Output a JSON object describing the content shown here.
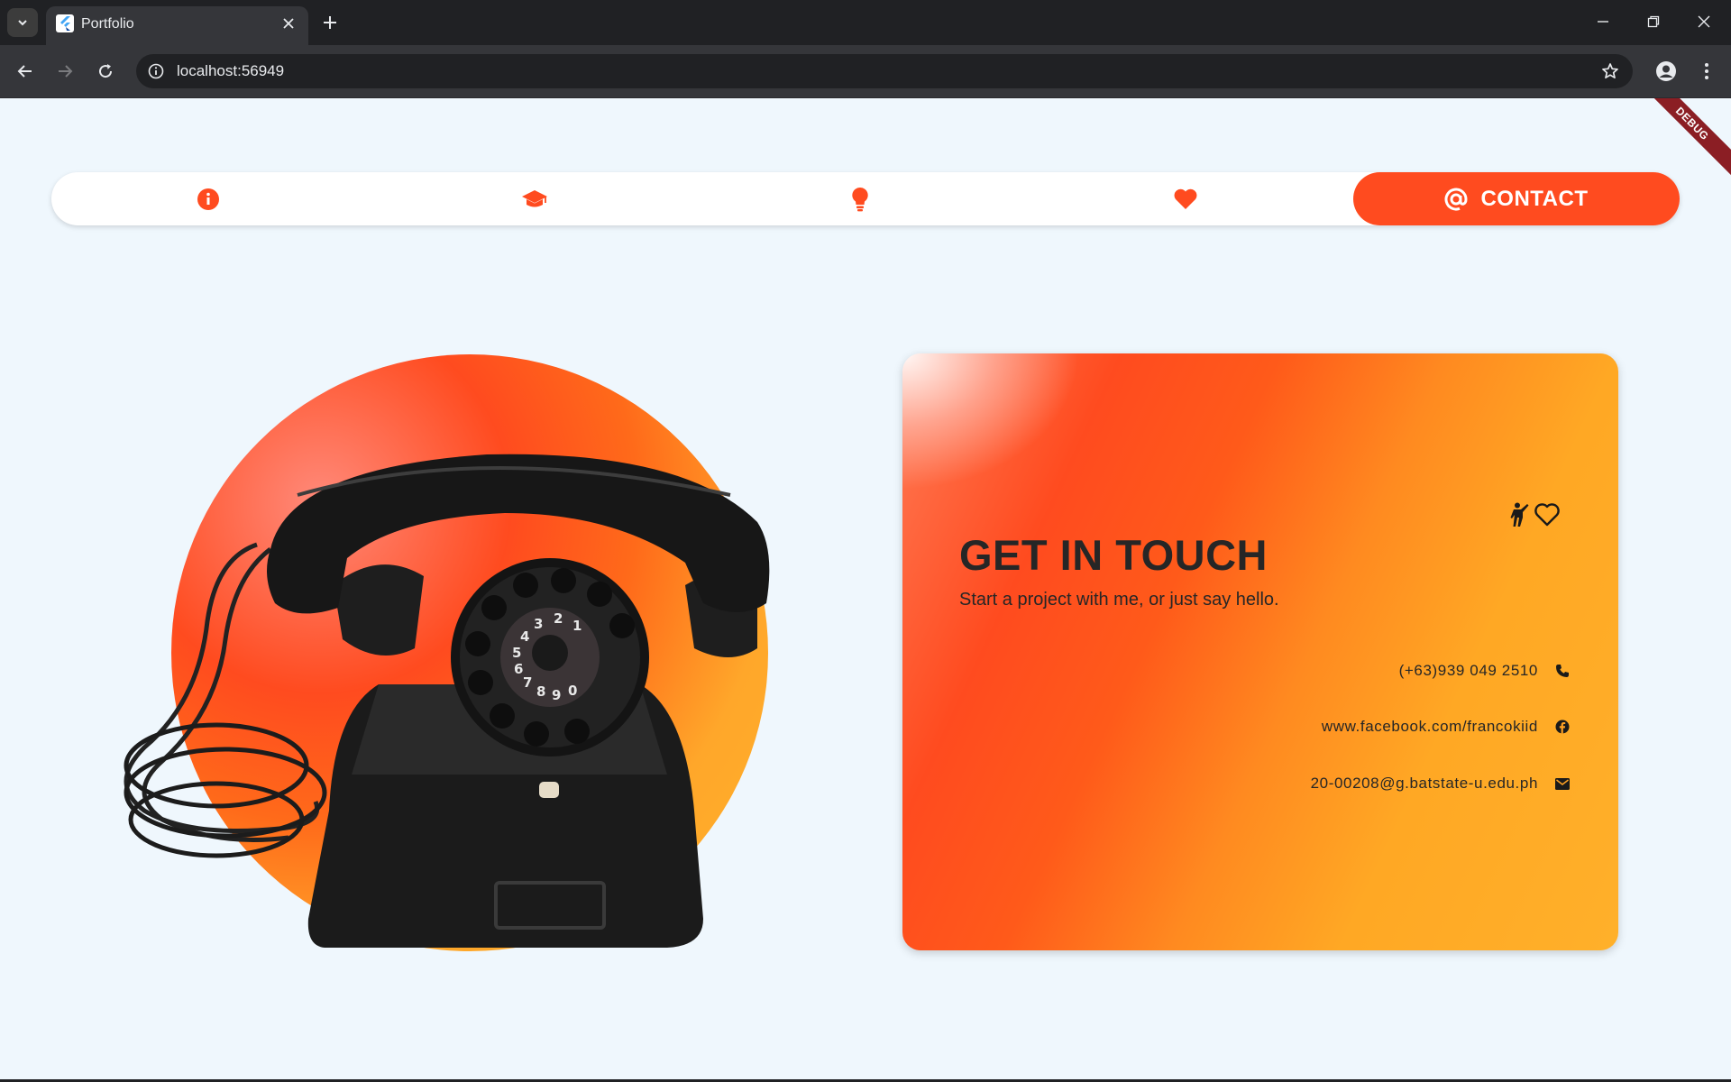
{
  "browser": {
    "tab_title": "Portfolio",
    "url": "localhost:56949"
  },
  "page": {
    "debug_banner": "DEBUG",
    "nav": {
      "items": [
        {
          "icon": "info-icon"
        },
        {
          "icon": "graduation-cap-icon"
        },
        {
          "icon": "lightbulb-icon"
        },
        {
          "icon": "heart-icon"
        }
      ],
      "active": {
        "icon": "at-sign-icon",
        "label": "CONTACT"
      }
    },
    "contact_card": {
      "title": "GET IN TOUCH",
      "subtitle": "Start a project with me, or just say hello.",
      "phone": "(+63)939 049 2510",
      "facebook": "www.facebook.com/francokiid",
      "email": "20-00208@g.batstate-u.edu.ph"
    },
    "colors": {
      "accent": "#ff4b1f",
      "background": "#eff7fd",
      "card_warm": "#ffb02a"
    }
  }
}
